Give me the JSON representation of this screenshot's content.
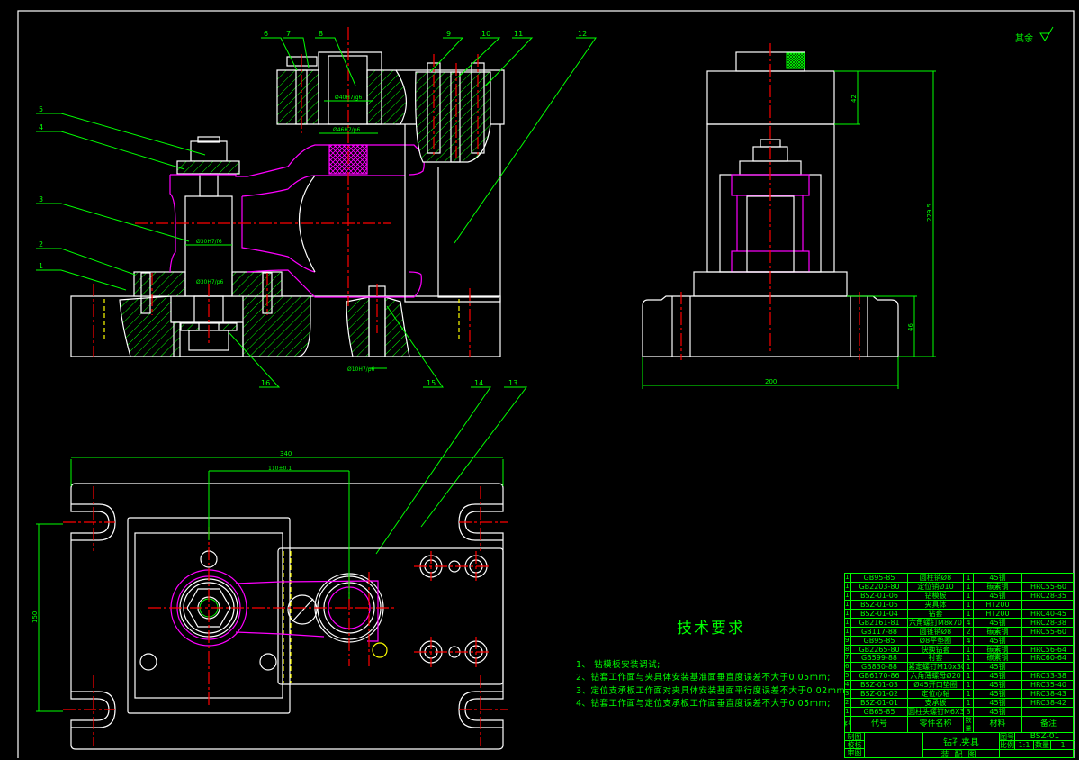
{
  "drawing": {
    "part_numbers": [
      "1",
      "2",
      "3",
      "4",
      "5",
      "6",
      "7",
      "8",
      "9",
      "10",
      "11",
      "12",
      "13",
      "14",
      "15",
      "16"
    ],
    "surface_note": "其余",
    "roughness_symbol": "roughness-check-icon",
    "fits": {
      "bushing_inner": "Ø40H7/g6",
      "bushing_outer": "Ø46H7/p6",
      "mandrel": "Ø30H7/f6",
      "mandrel_base": "Ø30H7/p6",
      "pin": "Ø10H7/p6"
    },
    "dimensions": {
      "side_top": "42",
      "side_height": "229.5",
      "side_base": "46",
      "side_width": "200",
      "plan_length": "340",
      "plan_center": "110±0.1",
      "plan_width": "150"
    },
    "colors": {
      "background": "#000000",
      "outline": "#ffffff",
      "dimension": "#00ff00",
      "centerline": "#ff0000",
      "workpiece": "#ff00ff",
      "hidden": "#ffff00"
    }
  },
  "tech_requirements": {
    "title": "技术要求",
    "items": [
      "1、  钻模板安装调试;",
      "2、钻套工作面与夹具体安装基准面垂直度误差不大于0.05mm;",
      "3、定位支承板工作面对夹具体安装基面平行度误差不大于0.02mm;",
      "4、钻套工作面与定位支承板工作面垂直度误差不大于0.05mm;"
    ]
  },
  "bom": {
    "headers": [
      "序号",
      "代号",
      "零件名称",
      "数量",
      "材料",
      "备注"
    ],
    "rows": [
      [
        "16",
        "GB95-85",
        "圆柱销Ø8",
        "1",
        "45钢",
        ""
      ],
      [
        "15",
        "GB2203-80",
        "定位销Ø10",
        "1",
        "碳素钢",
        "HRC55-60"
      ],
      [
        "14",
        "BSZ-01-06",
        "钻模板",
        "1",
        "45钢",
        "HRC28-35"
      ],
      [
        "13",
        "BSZ-01-05",
        "夹具体",
        "1",
        "HT200",
        ""
      ],
      [
        "12",
        "BSZ-01-04",
        "钻套",
        "1",
        "HT200",
        "HRC40-45"
      ],
      [
        "11",
        "GB2161-81",
        "六角螺钉M8x70",
        "4",
        "45钢",
        "HRC28-38"
      ],
      [
        "10",
        "GB117-88",
        "圆锥销Ø8",
        "2",
        "碳素钢",
        "HRC55-60"
      ],
      [
        "9",
        "GB95-85",
        "Ø8平垫圈",
        "4",
        "45钢",
        ""
      ],
      [
        "8",
        "GB2265-80",
        "快换钻套",
        "1",
        "碳素钢",
        "HRC56-64"
      ],
      [
        "7",
        "GB599-88",
        "衬套",
        "1",
        "碳素钢",
        "HRC60-64"
      ],
      [
        "6",
        "GB830-88",
        "紧定螺钉M10x30",
        "1",
        "45钢",
        ""
      ],
      [
        "5",
        "GB6170-86",
        "六角薄螺母Ø20",
        "1",
        "45钢",
        "HRC33-38"
      ],
      [
        "4",
        "BSZ-01-03",
        "Ø45开口垫圈",
        "1",
        "45钢",
        "HRC35-40"
      ],
      [
        "3",
        "BSZ-01-02",
        "定位心轴",
        "1",
        "45钢",
        "HRC38-43"
      ],
      [
        "2",
        "BSZ-01-01",
        "支承板",
        "1",
        "45钢",
        "HRC38-42"
      ],
      [
        "1",
        "GB65-85",
        "圆柱头螺钉M6X34",
        "3",
        "45钢",
        ""
      ]
    ]
  },
  "title_block": {
    "drawn": "制图",
    "checked": "校核",
    "approved": "审图",
    "name": "钻孔夹具",
    "drawing_no_label": "图号",
    "drawing_no": "BSZ-01",
    "scale_label": "比例",
    "scale": "1:1",
    "qty_label": "数量",
    "qty": "1",
    "type": "装配图"
  }
}
